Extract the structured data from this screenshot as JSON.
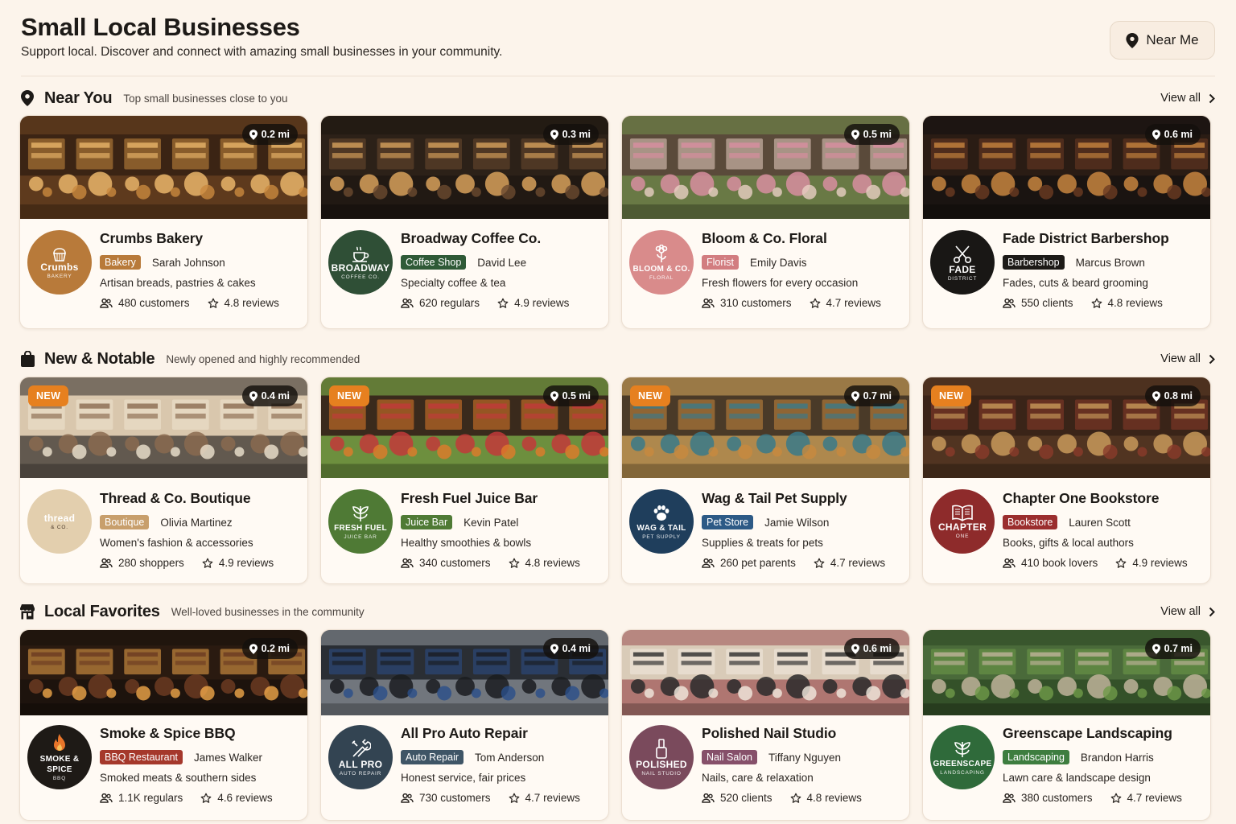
{
  "header": {
    "title": "Small Local Businesses",
    "subtitle": "Support local. Discover and connect with amazing small businesses in your community.",
    "near_me_label": "Near Me"
  },
  "view_all_label": "View all",
  "sections": [
    {
      "title": "Near You",
      "description": "Top small businesses close to you",
      "icon": "map-pin-icon",
      "cards": [
        {
          "name": "Crumbs Bakery",
          "category": "Bakery",
          "owner": "Sarah Johnson",
          "tagline": "Artisan breads, pastries & cakes",
          "audience": "480 customers",
          "reviews": "4.8 reviews",
          "distance": "0.2 mi",
          "logo_text": "Crumbs",
          "logo_sub": "BAKERY",
          "logo_color": "#b87a3a",
          "tag_color": "#b87a3a",
          "icon": "bakery-icon",
          "is_new": false
        },
        {
          "name": "Broadway Coffee Co.",
          "category": "Coffee Shop",
          "owner": "David Lee",
          "tagline": "Specialty coffee & tea",
          "audience": "620 regulars",
          "reviews": "4.9 reviews",
          "distance": "0.3 mi",
          "logo_text": "BROADWAY",
          "logo_sub": "COFFEE CO.",
          "logo_color": "#2f4f36",
          "tag_color": "#2f5a37",
          "icon": "coffee-cup-icon",
          "is_new": false
        },
        {
          "name": "Bloom & Co. Floral",
          "category": "Florist",
          "owner": "Emily Davis",
          "tagline": "Fresh flowers for every occasion",
          "audience": "310 customers",
          "reviews": "4.7 reviews",
          "distance": "0.5 mi",
          "logo_text": "BLOOM & CO.",
          "logo_sub": "FLORAL",
          "logo_color": "#d98b8b",
          "tag_color": "#d27d80",
          "icon": "flower-icon",
          "is_new": false
        },
        {
          "name": "Fade District Barbershop",
          "category": "Barbershop",
          "owner": "Marcus Brown",
          "tagline": "Fades, cuts & beard grooming",
          "audience": "550 clients",
          "reviews": "4.8 reviews",
          "distance": "0.6 mi",
          "logo_text": "FADE",
          "logo_sub": "DISTRICT",
          "logo_color": "#191715",
          "tag_color": "#1d1a17",
          "icon": "scissors-icon",
          "is_new": false
        }
      ]
    },
    {
      "title": "New & Notable",
      "description": "Newly opened and highly recommended",
      "icon": "shopping-bag-icon",
      "cards": [
        {
          "name": "Thread & Co. Boutique",
          "category": "Boutique",
          "owner": "Olivia Martinez",
          "tagline": "Women's fashion & accessories",
          "audience": "280 shoppers",
          "reviews": "4.9 reviews",
          "distance": "0.4 mi",
          "logo_text": "thread",
          "logo_sub": "& CO.",
          "logo_color": "#e3cfae",
          "tag_color": "#c89f6c",
          "icon": "none",
          "is_new": true
        },
        {
          "name": "Fresh Fuel Juice Bar",
          "category": "Juice Bar",
          "owner": "Kevin Patel",
          "tagline": "Healthy smoothies & bowls",
          "audience": "340 customers",
          "reviews": "4.8 reviews",
          "distance": "0.5 mi",
          "logo_text": "FRESH FUEL",
          "logo_sub": "JUICE BAR",
          "logo_color": "#4f7a35",
          "tag_color": "#4f7a35",
          "icon": "leaf-icon",
          "is_new": true
        },
        {
          "name": "Wag & Tail Pet Supply",
          "category": "Pet Store",
          "owner": "Jamie Wilson",
          "tagline": "Supplies & treats for pets",
          "audience": "260 pet parents",
          "reviews": "4.7 reviews",
          "distance": "0.7 mi",
          "logo_text": "WAG & TAIL",
          "logo_sub": "PET SUPPLY",
          "logo_color": "#1f3e5c",
          "tag_color": "#2d5a86",
          "icon": "paw-icon",
          "is_new": true
        },
        {
          "name": "Chapter One Bookstore",
          "category": "Bookstore",
          "owner": "Lauren Scott",
          "tagline": "Books, gifts & local authors",
          "audience": "410 book lovers",
          "reviews": "4.9 reviews",
          "distance": "0.8 mi",
          "logo_text": "CHAPTER",
          "logo_sub": "ONE",
          "logo_color": "#8e2b2b",
          "tag_color": "#9b2e2e",
          "icon": "book-icon",
          "is_new": true
        }
      ]
    },
    {
      "title": "Local Favorites",
      "description": "Well-loved businesses in the community",
      "icon": "storefront-icon",
      "cards": [
        {
          "name": "Smoke & Spice BBQ",
          "category": "BBQ Restaurant",
          "owner": "James Walker",
          "tagline": "Smoked meats & southern sides",
          "audience": "1.1K regulars",
          "reviews": "4.6 reviews",
          "distance": "0.2 mi",
          "logo_text": "SMOKE & SPICE",
          "logo_sub": "BBQ",
          "logo_color": "#1e1a16",
          "tag_color": "#a5382b",
          "icon": "flame-icon",
          "is_new": false
        },
        {
          "name": "All Pro Auto Repair",
          "category": "Auto Repair",
          "owner": "Tom Anderson",
          "tagline": "Honest service, fair prices",
          "audience": "730 customers",
          "reviews": "4.7 reviews",
          "distance": "0.4 mi",
          "logo_text": "ALL PRO",
          "logo_sub": "AUTO REPAIR",
          "logo_color": "#334452",
          "tag_color": "#3f5566",
          "icon": "wrench-icon",
          "is_new": false
        },
        {
          "name": "Polished Nail Studio",
          "category": "Nail Salon",
          "owner": "Tiffany Nguyen",
          "tagline": "Nails, care & relaxation",
          "audience": "520 clients",
          "reviews": "4.8 reviews",
          "distance": "0.6 mi",
          "logo_text": "POLISHED",
          "logo_sub": "NAIL STUDIO",
          "logo_color": "#7a4a5c",
          "tag_color": "#86506a",
          "icon": "nail-polish-icon",
          "is_new": false
        },
        {
          "name": "Greenscape Landscaping",
          "category": "Landscaping",
          "owner": "Brandon Harris",
          "tagline": "Lawn care & landscape design",
          "audience": "380 customers",
          "reviews": "4.7 reviews",
          "distance": "0.7 mi",
          "logo_text": "GREENSCAPE",
          "logo_sub": "LANDSCAPING",
          "logo_color": "#2f6a3a",
          "tag_color": "#3e7d3f",
          "icon": "leaf-icon",
          "is_new": false
        }
      ]
    }
  ]
}
